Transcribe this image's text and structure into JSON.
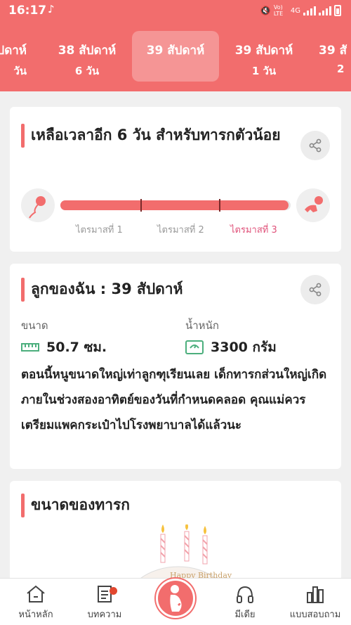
{
  "status": {
    "time": "16:17",
    "network": "4G",
    "volte": "Vo) LTE"
  },
  "weeks": [
    {
      "title": "ปดาห์",
      "days": "วัน"
    },
    {
      "title": "38 สัปดาห์",
      "days": "6 วัน"
    },
    {
      "title": "39 สัปดาห์",
      "days": ""
    },
    {
      "title": "39 สัปดาห์",
      "days": "1 วัน"
    },
    {
      "title": "39 สั",
      "days": "2"
    }
  ],
  "countdown": {
    "title": "เหลือเวลาอีก 6 วัน สำหรับทารกตัวน้อย",
    "progress_fraction": 0.99,
    "trimesters": [
      "ไตรมาสที่ 1",
      "ไตรมาสที่ 2",
      "ไตรมาสที่ 3"
    ]
  },
  "baby": {
    "title": "ลูกของฉัน :  39 สัปดาห์",
    "size_label": "ขนาด",
    "size_value": "50.7 ซม.",
    "weight_label": "น้ำหนัก",
    "weight_value": "3300 กรัม",
    "description": "ตอนนี้หนูขนาดใหญ่เท่าลูกฑุเรียนเลย เด็กทารกส่วนใหญ่เกิดภายในช่วงสองอาทิตย์ของวันที่กำหนดคลอด คุณแม่ควรเตรียมแพคกระเป๋าไปโรงพยาบาลได้แล้วนะ"
  },
  "size_section": {
    "title": "ขนาดของทารก",
    "cake_text": "Happy Birthday"
  },
  "nav": {
    "home": "หน้าหลัก",
    "articles": "บทความ",
    "media": "มีเดีย",
    "quiz": "แบบสอบถาม"
  },
  "colors": {
    "accent": "#f26d6d",
    "trimester_active": "#e0527a"
  }
}
